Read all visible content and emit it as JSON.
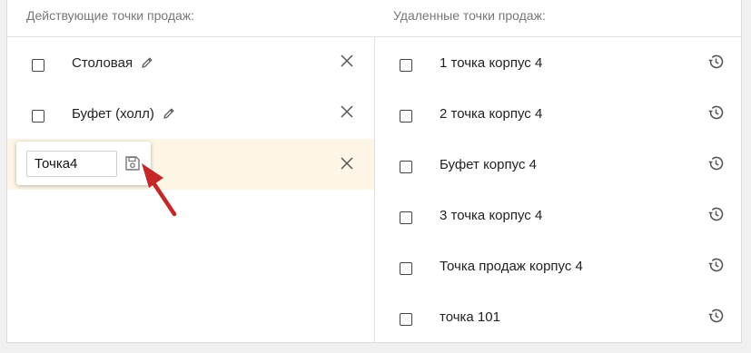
{
  "active": {
    "title": "Действующие точки продаж:",
    "items": [
      {
        "label": "Столовая"
      },
      {
        "label": "Буфет (холл)"
      }
    ],
    "editor": {
      "value": "Точка4"
    }
  },
  "deleted": {
    "title": "Удаленные точки продаж:",
    "items": [
      {
        "label": "1 точка корпус 4"
      },
      {
        "label": "2 точка корпус 4"
      },
      {
        "label": "Буфет корпус 4"
      },
      {
        "label": "3 точка корпус 4"
      },
      {
        "label": "Точка продаж корпус 4"
      },
      {
        "label": "точка 101"
      }
    ]
  },
  "colors": {
    "highlight_row": "#fdf6e6",
    "arrow": "#c62828",
    "icon": "#555555"
  }
}
